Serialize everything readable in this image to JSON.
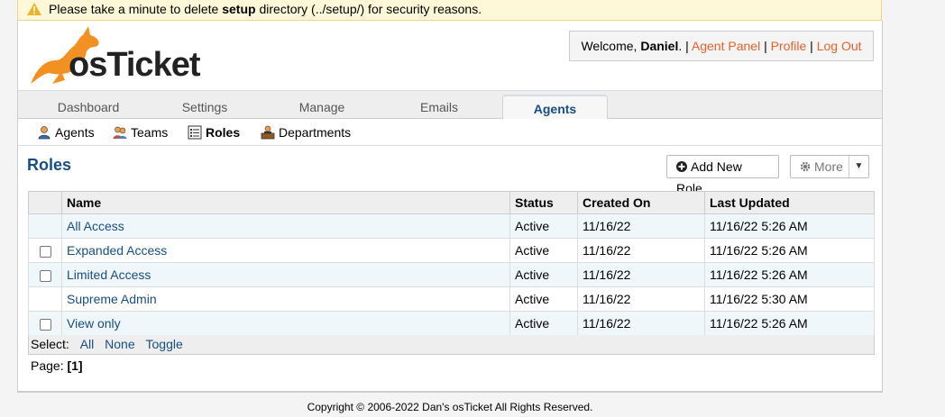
{
  "warning": {
    "prefix": "Please take a minute to delete ",
    "bold": "setup",
    "suffix": " directory (../setup/) for security reasons.",
    "icon": "warning-icon"
  },
  "logo": {
    "text": "osTicket",
    "icon": "kangaroo-logo"
  },
  "welcome": {
    "prefix": "Welcome, ",
    "user": "Daniel",
    "suffix": ". | ",
    "agent_panel": "Agent Panel",
    "sep1": " | ",
    "profile": "Profile",
    "sep2": " | ",
    "logout": "Log Out"
  },
  "nav": {
    "tabs": [
      "Dashboard",
      "Settings",
      "Manage",
      "Emails",
      "Agents"
    ],
    "active": "Agents"
  },
  "subnav": {
    "items": [
      {
        "label": "Agents",
        "icon": "agent-icon"
      },
      {
        "label": "Teams",
        "icon": "teams-icon"
      },
      {
        "label": "Roles",
        "icon": "roles-list-icon"
      },
      {
        "label": "Departments",
        "icon": "department-icon"
      }
    ],
    "active": "Roles"
  },
  "page": {
    "title": "Roles",
    "add_button": "Add New Role",
    "more_button": "More"
  },
  "table": {
    "headers": [
      "Name",
      "Status",
      "Created On",
      "Last Updated"
    ],
    "rows": [
      {
        "name": "All Access",
        "status": "Active",
        "created": "11/16/22",
        "updated": "11/16/22 5:26 AM",
        "checkbox": false
      },
      {
        "name": "Expanded Access",
        "status": "Active",
        "created": "11/16/22",
        "updated": "11/16/22 5:26 AM",
        "checkbox": true
      },
      {
        "name": "Limited Access",
        "status": "Active",
        "created": "11/16/22",
        "updated": "11/16/22 5:26 AM",
        "checkbox": true
      },
      {
        "name": "Supreme Admin",
        "status": "Active",
        "created": "11/16/22",
        "updated": "11/16/22 5:30 AM",
        "checkbox": false
      },
      {
        "name": "View only",
        "status": "Active",
        "created": "11/16/22",
        "updated": "11/16/22 5:26 AM",
        "checkbox": true
      }
    ]
  },
  "select": {
    "label": "Select:",
    "all": "All",
    "none": "None",
    "toggle": "Toggle"
  },
  "pager": {
    "label": "Page:",
    "current": "[1]"
  },
  "footer": {
    "text": "Copyright © 2006-2022 Dan's osTicket All Rights Reserved."
  },
  "colors": {
    "accent": "#184e81",
    "link_orange": "#e8612c",
    "warning_bg": "#fef7d8"
  }
}
